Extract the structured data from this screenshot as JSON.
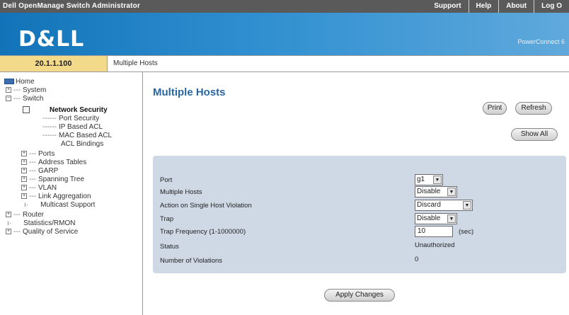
{
  "topbar": {
    "title": "Dell OpenManage Switch Administrator",
    "menu": [
      "Support",
      "Help",
      "About",
      "Log O"
    ]
  },
  "banner": {
    "logo": "D&LL",
    "product": "PowerConnect 6"
  },
  "address": {
    "ip": "20.1.1.100",
    "breadcrumb": "Multiple Hosts"
  },
  "tree": [
    {
      "label": "Home"
    },
    {
      "label": "System"
    },
    {
      "label": "Switch"
    },
    {
      "label": "Network Security"
    },
    {
      "label": "Port Security"
    },
    {
      "label": "IP Based ACL"
    },
    {
      "label": "MAC Based ACL"
    },
    {
      "label": "ACL Bindings"
    },
    {
      "label": "Ports"
    },
    {
      "label": "Address Tables"
    },
    {
      "label": "GARP"
    },
    {
      "label": "Spanning Tree"
    },
    {
      "label": "VLAN"
    },
    {
      "label": "Link Aggregation"
    },
    {
      "label": "Multicast Support"
    },
    {
      "label": "Router"
    },
    {
      "label": "Statistics/RMON"
    },
    {
      "label": "Quality of Service"
    }
  ],
  "main": {
    "title": "Multiple Hosts",
    "buttons": {
      "print": "Print",
      "refresh": "Refresh",
      "show_all": "Show All",
      "apply": "Apply Changes"
    },
    "form": {
      "port_label": "Port",
      "port_value": "g1",
      "multiple_hosts_label": "Multiple Hosts",
      "multiple_hosts_value": "Disable",
      "action_label": "Action on Single Host Violation",
      "action_value": "Discard",
      "trap_label": "Trap",
      "trap_value": "Disable",
      "trap_freq_label": "Trap Frequency (1-1000000)",
      "trap_freq_value": "10",
      "trap_freq_unit": "(sec)",
      "status_label": "Status",
      "status_value": "Unauthorized",
      "violations_label": "Number of Violations",
      "violations_value": "0"
    }
  },
  "colors": {
    "topbar": "#5a5a5a",
    "banner": "#1273b8",
    "ip_bg": "#f3d98a",
    "panel": "#cfd9e6",
    "title": "#2a66a0"
  }
}
